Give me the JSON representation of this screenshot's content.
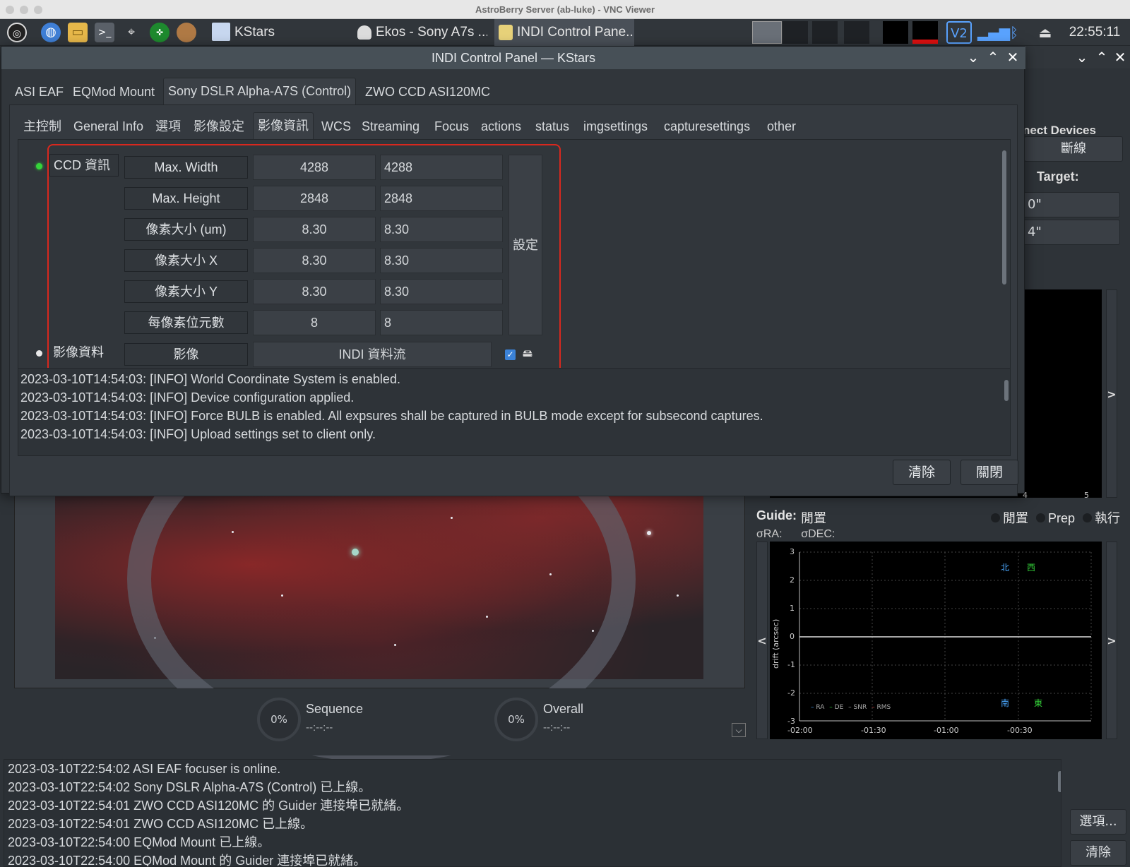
{
  "mac_window": {
    "title": "AstroBerry Server (ab-luke) - VNC Viewer"
  },
  "taskbar": {
    "tasks": [
      {
        "label": "KStars"
      },
      {
        "label": "Ekos - Sony A7s ..."
      },
      {
        "label": "INDI Control Pane..."
      }
    ],
    "clock": "22:55:11"
  },
  "dialog": {
    "title": "INDI Control Panel — KStars",
    "device_tabs": [
      "ASI EAF",
      "EQMod Mount",
      "Sony DSLR Alpha-A7S (Control)",
      "ZWO CCD ASI120MC"
    ],
    "group_tabs": [
      "主控制",
      "General Info",
      "選項",
      "影像設定",
      "影像資訊",
      "WCS",
      "Streaming",
      "Focus",
      "actions",
      "status",
      "imgsettings",
      "capturesettings",
      "other"
    ],
    "ccd_info": {
      "label": "CCD 資訊",
      "set_button": "設定",
      "rows": [
        {
          "name": "Max. Width",
          "value": "4288",
          "input": "4288"
        },
        {
          "name": "Max. Height",
          "value": "2848",
          "input": "2848"
        },
        {
          "name": "像素大小 (um)",
          "value": "8.30",
          "input": "8.30"
        },
        {
          "name": "像素大小 X",
          "value": "8.30",
          "input": "8.30"
        },
        {
          "name": "像素大小 Y",
          "value": "8.30",
          "input": "8.30"
        },
        {
          "name": "每像素位元數",
          "value": "8",
          "input": "8"
        }
      ]
    },
    "image_data": {
      "label": "影像資料",
      "name": "影像",
      "value": "INDI 資料流"
    },
    "log": [
      "2023-03-10T14:54:03: [INFO] World Coordinate System is enabled.",
      "2023-03-10T14:54:03: [INFO] Device configuration applied.",
      "2023-03-10T14:54:03: [INFO] Force BULB is enabled. All expsures shall be captured in BULB mode except for subsecond captures.",
      "2023-03-10T14:54:03: [INFO] Upload settings set to client only."
    ],
    "buttons": {
      "clear": "清除",
      "close": "關閉"
    }
  },
  "ekos": {
    "sequence": {
      "percent": "0%",
      "label": "Sequence",
      "time": "--:--:--"
    },
    "overall": {
      "percent": "0%",
      "label": "Overall",
      "time": "--:--:--"
    },
    "right": {
      "connect_header": "nect Devices",
      "disconnect": "斷線",
      "target_label": "Target:",
      "ra_partial": "0\"",
      "dec_partial": "4\"",
      "top_plot_ticks": [
        "4",
        "5"
      ],
      "guide_label": "Guide:",
      "guide_status": "閒置",
      "guide_states": [
        "閒置",
        "Prep",
        "執行"
      ],
      "sigma": "σRA:      σDEC:",
      "drift_plot": {
        "ylabel": "drift (arcsec)",
        "y_ticks": [
          "3",
          "2",
          "1",
          "0",
          "-1",
          "-2",
          "-3"
        ],
        "x_ticks": [
          "-02:00",
          "-01:30",
          "-01:00",
          "-00:30"
        ],
        "compass": {
          "north": "北",
          "west": "西",
          "south": "南",
          "east": "東"
        },
        "legend": [
          "RA",
          "DE",
          "SNR",
          "RMS"
        ]
      },
      "options_button": "選項...",
      "clear_button": "清除"
    },
    "log": [
      "2023-03-10T22:54:02 ASI EAF focuser is online.",
      "2023-03-10T22:54:02 Sony DSLR Alpha-A7S (Control) 已上線。",
      "2023-03-10T22:54:01 ZWO CCD ASI120MC 的 Guider 連接埠已就緒。",
      "2023-03-10T22:54:01 ZWO CCD ASI120MC 已上線。",
      "2023-03-10T22:54:00 EQMod Mount 已上線。",
      "2023-03-10T22:54:00 EQMod Mount 的 Guider 連接埠已就緒。"
    ]
  },
  "colors": {
    "accent_red": "#d8281e",
    "status_green": "#35d43a",
    "plot_bg": "#000000"
  }
}
